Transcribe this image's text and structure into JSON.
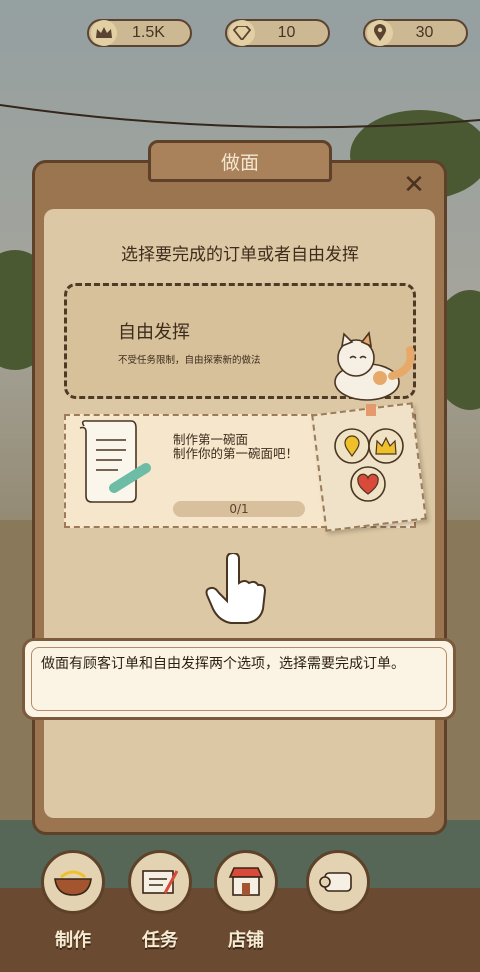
{
  "currency": {
    "crowns": "1.5K",
    "diamonds": "10",
    "locations": "30"
  },
  "dialog": {
    "title": "做面",
    "heading": "选择要完成的订单或者自由发挥",
    "free_play": {
      "title": "自由发挥",
      "subtitle": "不受任务限制，自由探索新的做法"
    },
    "order": {
      "title": "制作第一碗面",
      "description": "制作你的第一碗面吧！",
      "progress": "0/1"
    }
  },
  "tooltip": {
    "text": "做面有顾客订单和自由发挥两个选项，选择需要完成订单。"
  },
  "bottom_nav": {
    "make": "制作",
    "tasks": "任务",
    "shop": "店铺"
  },
  "colors": {
    "panel": "#9a7550",
    "panel_inner": "#dcc8a4",
    "outline": "#5e4129",
    "accent_gold": "#f0c02a",
    "accent_red": "#d84a3a"
  }
}
